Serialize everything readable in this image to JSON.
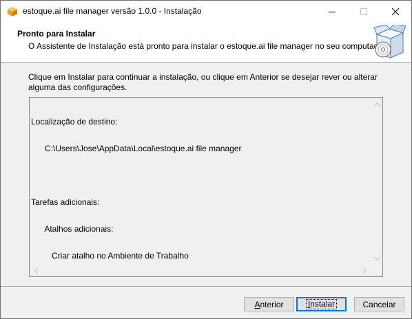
{
  "window": {
    "title": "estoque.ai file manager versão 1.0.0 - Instalação",
    "icon": "package-box-icon"
  },
  "header": {
    "title": "Pronto para Instalar",
    "subtitle": "O Assistente de Instalação está pronto para instalar o estoque.ai file manager no seu computador.",
    "icon": "installer-box-cd-icon"
  },
  "body": {
    "instructions": "Clique em Instalar para continuar a instalação, ou clique em Anterior se desejar rever ou alterar alguma das configurações."
  },
  "summary": {
    "lines": [
      "Localização de destino:",
      "      C:\\Users\\Jose\\AppData\\Local\\estoque.ai file manager",
      "",
      "Tarefas adicionais:",
      "      Atalhos adicionais:",
      "         Criar atalho no Ambiente de Trabalho"
    ]
  },
  "buttons": {
    "back": {
      "prefix": "",
      "accel": "A",
      "rest": "nterior"
    },
    "install": {
      "prefix": "",
      "accel": "I",
      "rest": "nstalar"
    },
    "cancel": {
      "label": "Cancelar"
    }
  },
  "colors": {
    "focus_border": "#0078d7",
    "dialog_bg": "#f0f0f0"
  }
}
